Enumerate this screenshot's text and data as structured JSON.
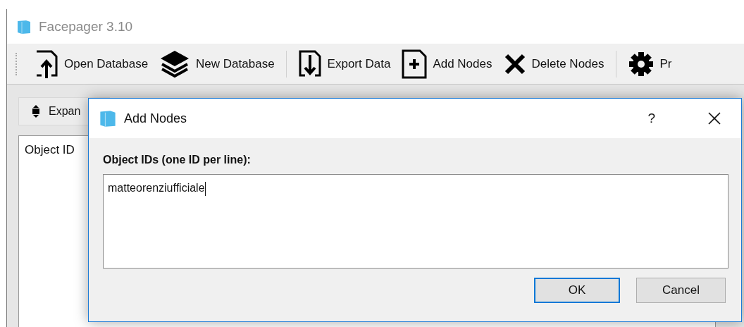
{
  "window": {
    "title": "Facepager 3.10"
  },
  "toolbar": [
    {
      "kind": "button",
      "label": "Open Database"
    },
    {
      "kind": "button",
      "label": "New Database"
    },
    {
      "kind": "separator"
    },
    {
      "kind": "button",
      "label": "Export Data"
    },
    {
      "kind": "button",
      "label": "Add Nodes"
    },
    {
      "kind": "button",
      "label": "Delete Nodes"
    },
    {
      "kind": "separator"
    },
    {
      "kind": "button",
      "label": "Pr"
    }
  ],
  "expand_button": {
    "label": "Expan"
  },
  "tree": {
    "column": "Object ID"
  },
  "dialog": {
    "title": "Add Nodes",
    "help": "?",
    "label": "Object IDs (one ID per line):",
    "value": "matteorenziufficiale",
    "buttons": [
      {
        "label": "OK",
        "default": true
      },
      {
        "label": "Cancel",
        "default": false
      }
    ]
  }
}
